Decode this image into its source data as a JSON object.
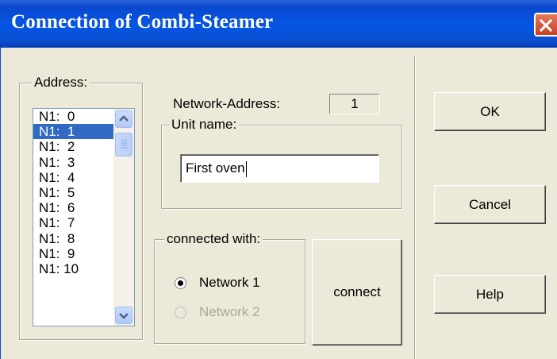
{
  "window": {
    "title": "Connection of Combi-Steamer"
  },
  "address_group": {
    "legend": "Address:",
    "items": [
      "N1:  0",
      "N1:  1",
      "N1:  2",
      "N1:  3",
      "N1:  4",
      "N1:  5",
      "N1:  6",
      "N1:  7",
      "N1:  8",
      "N1:  9",
      "N1: 10"
    ],
    "selected_index": 1
  },
  "network_address": {
    "label": "Network-Address:",
    "value": "1"
  },
  "unit_name": {
    "legend": "Unit name:",
    "value": "First oven"
  },
  "connected_with": {
    "legend": "connected with:",
    "options": [
      {
        "label": "Network 1",
        "checked": true,
        "enabled": true
      },
      {
        "label": "Network 2",
        "checked": false,
        "enabled": false
      }
    ]
  },
  "buttons": {
    "connect": "connect",
    "ok": "OK",
    "cancel": "Cancel",
    "help": "Help"
  }
}
